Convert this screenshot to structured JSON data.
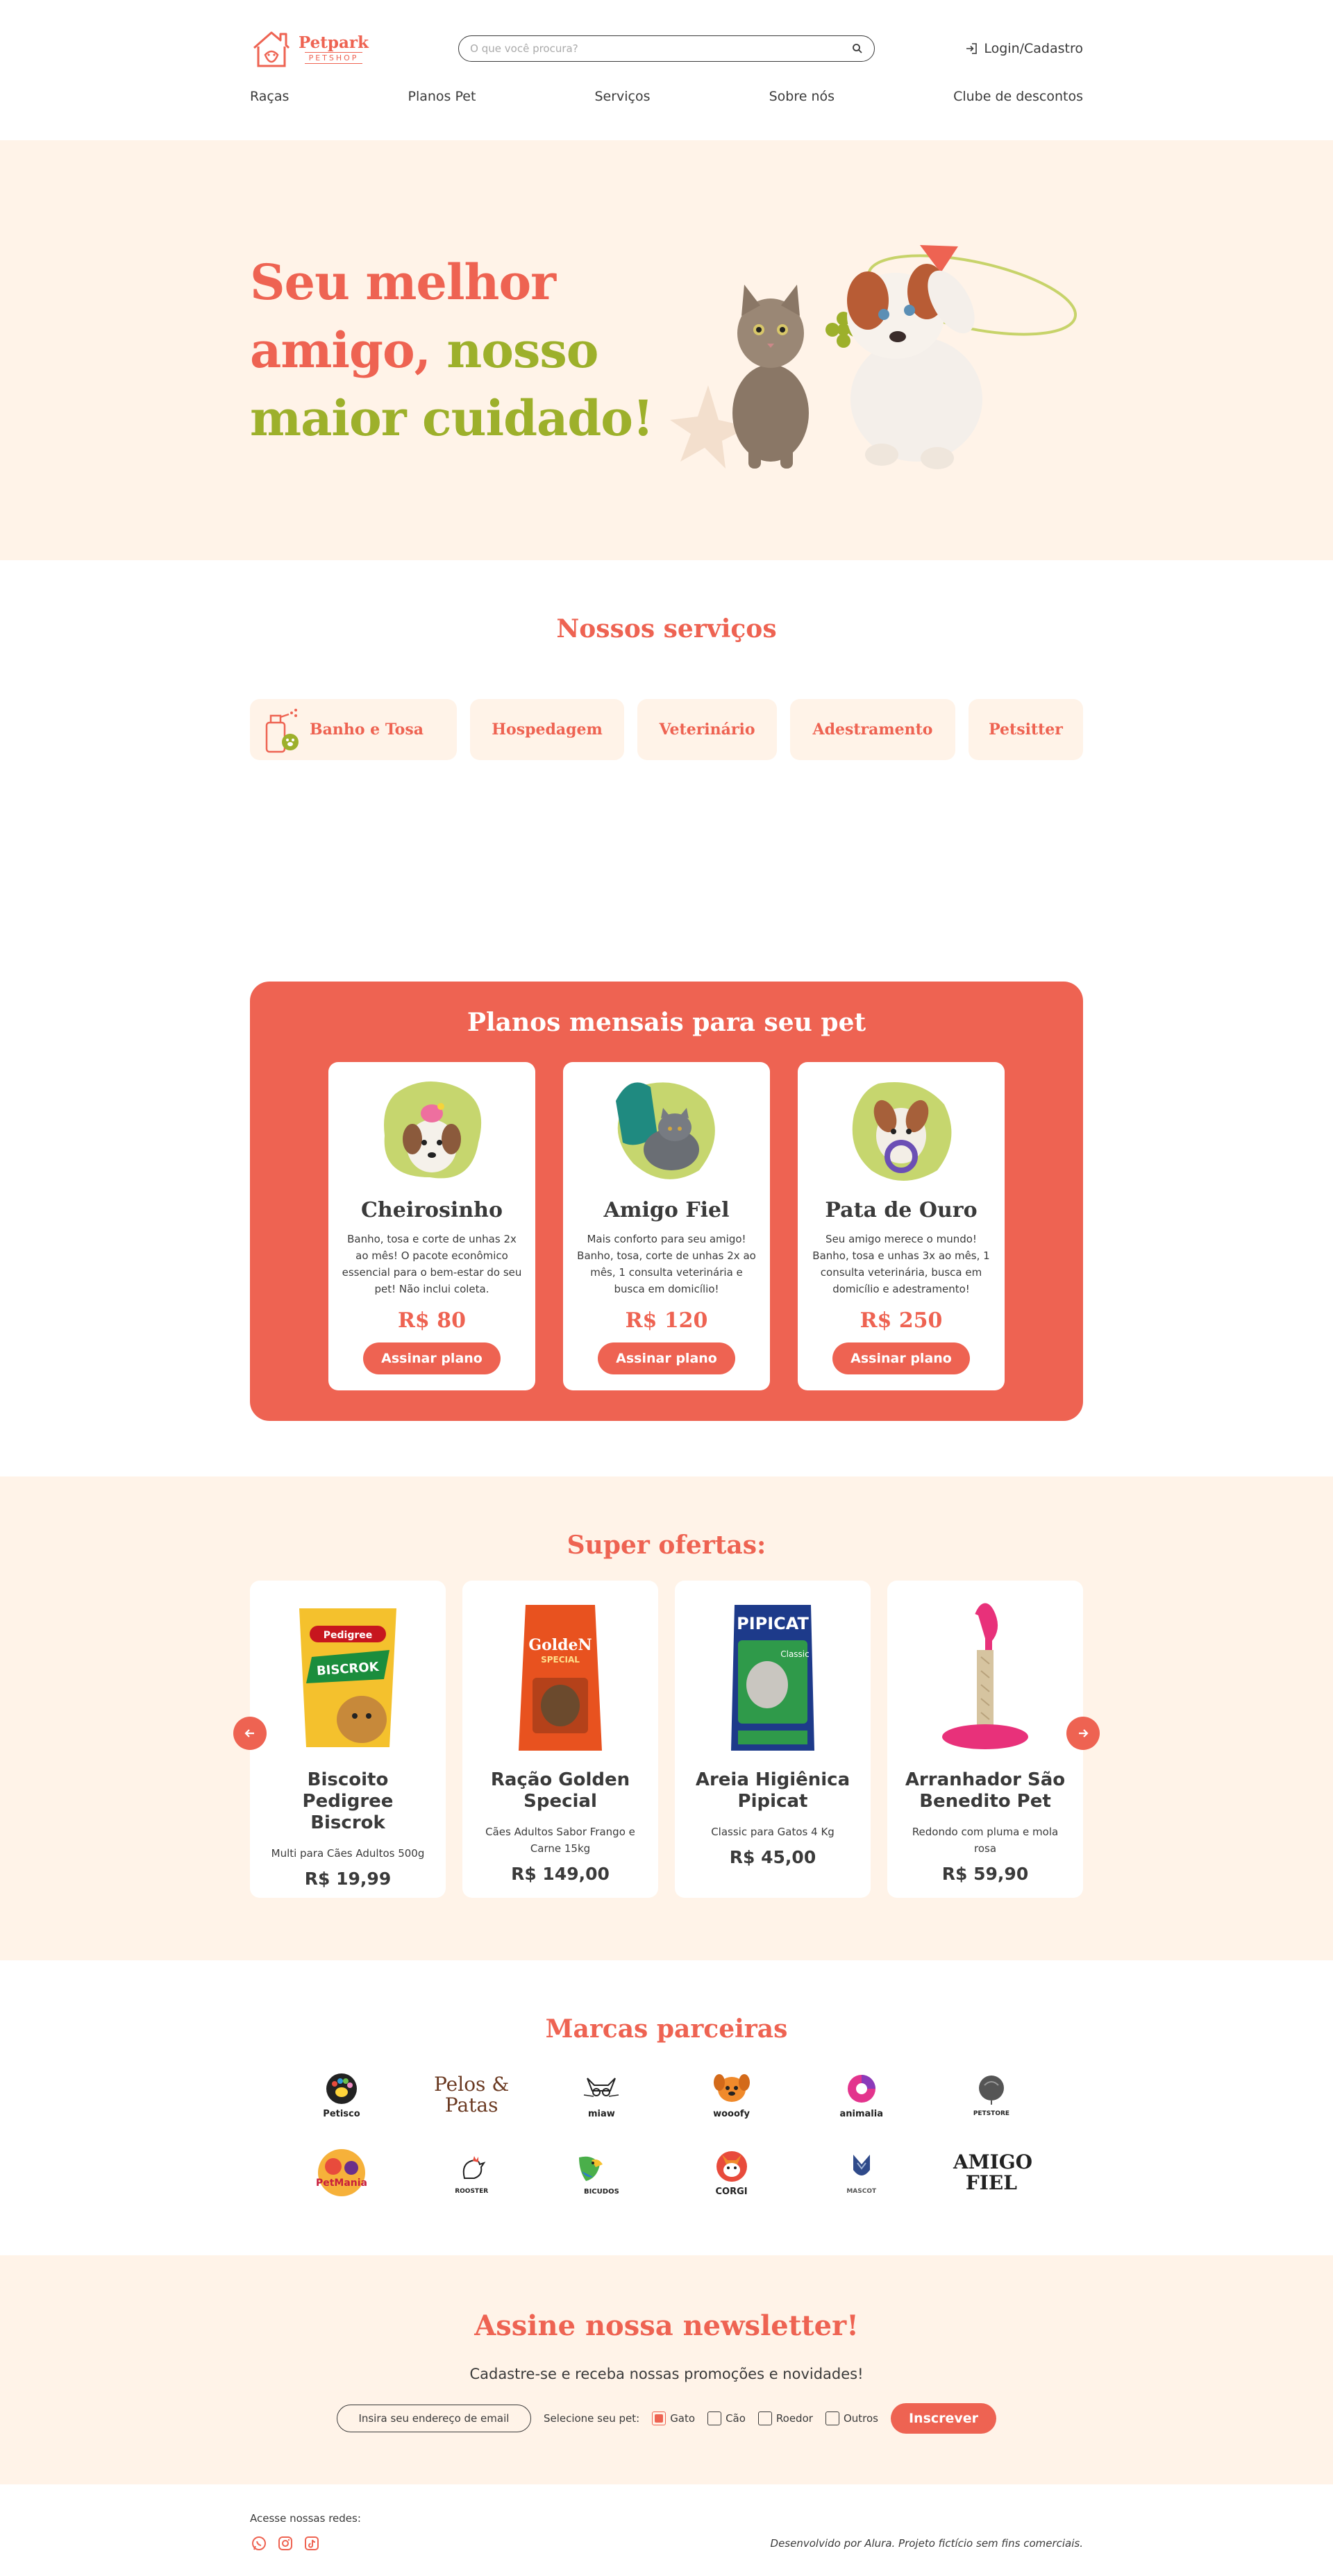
{
  "brand": {
    "name": "Petpark",
    "tagline": "PETSHOP",
    "color_primary": "#ee6352",
    "color_secondary": "#9db02b",
    "color_cream": "#fff3e8"
  },
  "header": {
    "search_placeholder": "O que você procura?",
    "login_label": "Login/Cadastro",
    "nav": [
      "Raças",
      "Planos Pet",
      "Serviços",
      "Sobre nós",
      "Clube de descontos"
    ]
  },
  "hero": {
    "line1": "Seu melhor",
    "line2_red": "amigo,",
    "line2_green": "nosso",
    "line3": "maior cuidado!"
  },
  "services": {
    "title": "Nossos serviços",
    "tabs": [
      "Banho e Tosa",
      "Hospedagem",
      "Veterinário",
      "Adestramento",
      "Petsitter"
    ]
  },
  "plans": {
    "title": "Planos mensais para seu pet",
    "items": [
      {
        "name": "Cheirosinho",
        "desc": "Banho, tosa e corte de unhas 2x ao mês! O pacote econômico essencial para o bem-estar do seu pet! Não inclui coleta.",
        "price": "R$ 80",
        "button": "Assinar plano"
      },
      {
        "name": "Amigo Fiel",
        "desc": "Mais conforto para seu amigo! Banho, tosa, corte de unhas 2x ao mês, 1 consulta veterinária e busca em domicílio!",
        "price": "R$ 120",
        "button": "Assinar plano"
      },
      {
        "name": "Pata de Ouro",
        "desc": "Seu amigo merece o mundo! Banho, tosa e unhas 3x ao mês, 1 consulta veterinária, busca em domicílio e adestramento!",
        "price": "R$ 250",
        "button": "Assinar plano"
      }
    ]
  },
  "offers": {
    "title": "Super ofertas:",
    "items": [
      {
        "name": "Biscoito Pedigree Biscrok",
        "desc": "Multi para Cães Adultos 500g",
        "price": "R$ 19,99",
        "pack_top": "Pedigree",
        "pack_main": "BISCROK"
      },
      {
        "name": "Ração Golden Special",
        "desc": "Cães Adultos Sabor Frango e Carne 15kg",
        "price": "R$ 149,00",
        "pack_top": "GoldeN",
        "pack_main": "SPECIAL"
      },
      {
        "name": "Areia Higiênica Pipicat",
        "desc": "Classic para Gatos 4 Kg",
        "price": "R$ 45,00",
        "pack_top": "PIPICAT",
        "pack_main": "Classic"
      },
      {
        "name": "Arranhador São Benedito Pet",
        "desc": "Redondo com pluma e mola rosa",
        "price": "R$ 59,90"
      }
    ]
  },
  "brands": {
    "title": "Marcas parceiras",
    "items": [
      "Petisco",
      "Pelos & Patas",
      "miaw",
      "wooofy",
      "animalia",
      "PETSTORE",
      "PetMania",
      "ROOSTER",
      "BICUDOS",
      "CORGI",
      "MASCOT",
      "AMIGO FIEL"
    ]
  },
  "newsletter": {
    "title": "Assine nossa newsletter!",
    "subtitle": "Cadastre-se e receba nossas promoções e novidades!",
    "email_placeholder": "Insira seu endereço de email",
    "pet_label": "Selecione seu pet:",
    "options": [
      {
        "label": "Gato",
        "checked": true
      },
      {
        "label": "Cão",
        "checked": false
      },
      {
        "label": "Roedor",
        "checked": false
      },
      {
        "label": "Outros",
        "checked": false
      }
    ],
    "button": "Inscrever"
  },
  "footer": {
    "social_label": "Acesse nossas redes:",
    "credit": "Desenvolvido por Alura. Projeto fictício sem fins comerciais."
  }
}
